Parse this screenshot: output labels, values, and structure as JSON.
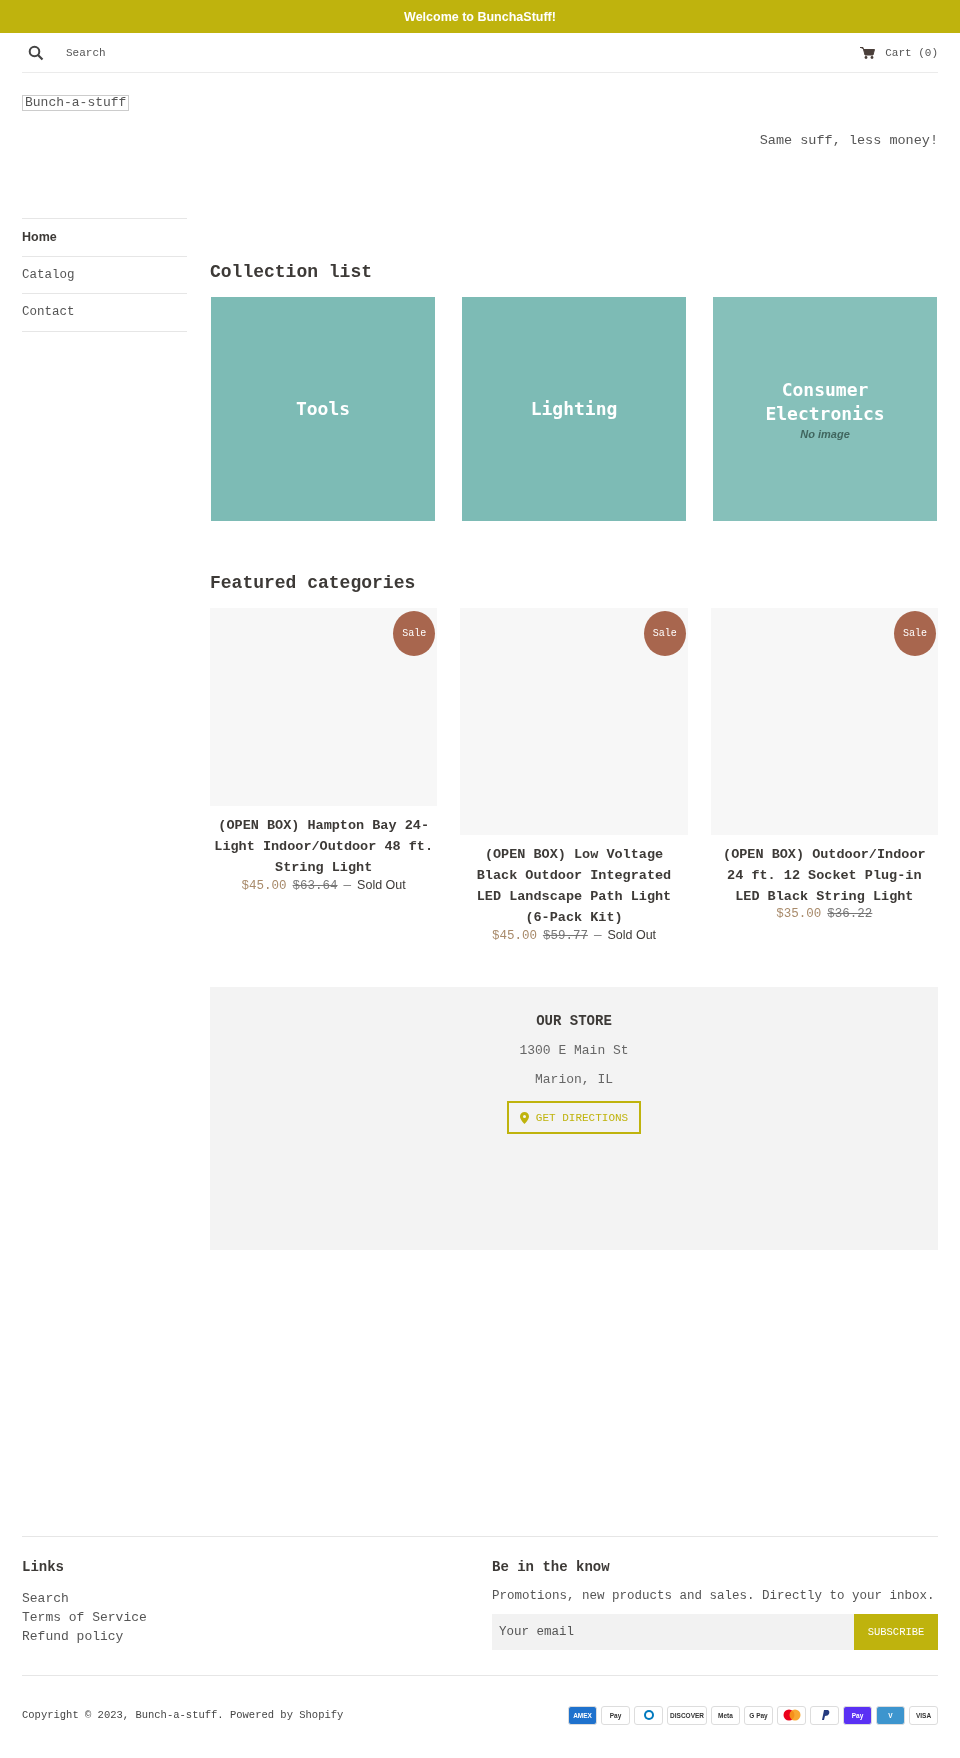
{
  "announcement": "Welcome to BunchaStuff!",
  "header": {
    "search_placeholder": "Search",
    "cart": "Cart (0)"
  },
  "logo": "Bunch-a-stuff",
  "tagline": "Same suff, less money!",
  "nav": [
    {
      "label": "Home",
      "selected": true
    },
    {
      "label": "Catalog",
      "selected": false
    },
    {
      "label": "Contact",
      "selected": false
    }
  ],
  "collection_list": {
    "title": "Collection list",
    "items": [
      {
        "title": "Tools",
        "no_image": false
      },
      {
        "title": "Lighting",
        "no_image": false
      },
      {
        "title": "Consumer Electronics",
        "no_image": true,
        "no_image_label": "No image"
      }
    ]
  },
  "featured": {
    "title": "Featured categories",
    "products": [
      {
        "badge": "Sale",
        "tall": false,
        "title": "(OPEN BOX) Hampton Bay 24-Light Indoor/Outdoor 48 ft. String Light",
        "price": "$45.00",
        "compare_price": "$63.64",
        "separator": "—",
        "status": "Sold Out"
      },
      {
        "badge": "Sale",
        "tall": true,
        "title": "(OPEN BOX) Low Voltage Black Outdoor Integrated LED Landscape Path Light (6-Pack Kit)",
        "price": "$45.00",
        "compare_price": "$59.77",
        "separator": "—",
        "status": "Sold Out"
      },
      {
        "badge": "Sale",
        "tall": true,
        "title": "(OPEN BOX) Outdoor/Indoor 24 ft. 12 Socket Plug-in LED Black String Light",
        "price": "$35.00",
        "compare_price": "$36.22"
      }
    ]
  },
  "store": {
    "title": "OUR STORE",
    "address": [
      "1300 E Main St",
      "Marion, IL"
    ],
    "button": "GET DIRECTIONS"
  },
  "footer": {
    "links_title": "Links",
    "links": [
      "Search",
      "Terms of Service",
      "Refund policy"
    ],
    "newsletter_title": "Be in the know",
    "newsletter_text": "Promotions, new products and sales. Directly to your inbox.",
    "email_placeholder": "Your email",
    "subscribe": "SUBSCRIBE",
    "copyright": "Copyright © 2023, Bunch-a-stuff. Powered by Shopify",
    "payments": [
      {
        "kind": "text",
        "label": "AMEX",
        "color": "#1f72cd"
      },
      {
        "kind": "text",
        "label": "Pay",
        "color": "#ffffff"
      },
      {
        "kind": "diners",
        "color": "#ffffff"
      },
      {
        "kind": "text",
        "label": "DISCOVER",
        "color": "#ffffff"
      },
      {
        "kind": "text",
        "label": "Meta",
        "color": "#ffffff"
      },
      {
        "kind": "text",
        "label": "G Pay",
        "color": "#ffffff"
      },
      {
        "kind": "mastercard",
        "color": "#ffffff"
      },
      {
        "kind": "paypal",
        "color": "#ffffff"
      },
      {
        "kind": "text",
        "label": "Pay",
        "color": "#5a31f4"
      },
      {
        "kind": "text",
        "label": "V",
        "color": "#3d95ce"
      },
      {
        "kind": "text",
        "label": "VISA",
        "color": "#ffffff"
      }
    ]
  }
}
